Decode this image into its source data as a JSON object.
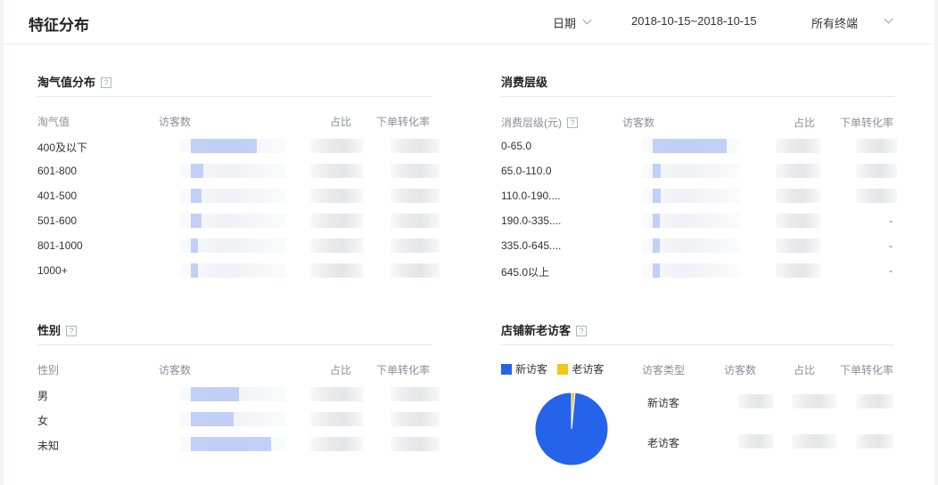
{
  "page_title": "特征分布",
  "filters": {
    "date_label": "日期",
    "date_range": "2018-10-15~2018-10-15",
    "terminal": "所有终端"
  },
  "colors": {
    "bar": "#b7c9f5",
    "new_visitor": "#2563eb",
    "old_visitor": "#f5c518"
  },
  "taoqi": {
    "title": "淘气值分布",
    "help": "?",
    "headers": {
      "c1": "淘气值",
      "c2": "访客数",
      "c3": "占比",
      "c4": "下单转化率"
    },
    "rows": [
      {
        "label": "400及以下",
        "share": 0.62
      },
      {
        "label": "601-800",
        "share": 0.12
      },
      {
        "label": "401-500",
        "share": 0.1
      },
      {
        "label": "501-600",
        "share": 0.1
      },
      {
        "label": "801-1000",
        "share": 0.06
      },
      {
        "label": "1000+",
        "share": 0.06
      }
    ]
  },
  "spending": {
    "title": "消费层级",
    "headers": {
      "c1": "消费层级(元)",
      "help": "?",
      "c2": "访客数",
      "c3": "占比",
      "c4": "下单转化率"
    },
    "rows": [
      {
        "label": "0-65.0",
        "share": 0.75,
        "rate": ""
      },
      {
        "label": "65.0-110.0",
        "share": 0.08,
        "rate": ""
      },
      {
        "label": "110.0-190....",
        "share": 0.08,
        "rate": ""
      },
      {
        "label": "190.0-335....",
        "share": 0.03,
        "rate": "-"
      },
      {
        "label": "335.0-645....",
        "share": 0.03,
        "rate": "-"
      },
      {
        "label": "645.0以上",
        "share": 0.03,
        "rate": "-"
      }
    ]
  },
  "gender": {
    "title": "性别",
    "help": "?",
    "headers": {
      "c1": "性别",
      "c2": "访客数",
      "c3": "占比",
      "c4": "下单转化率"
    },
    "rows": [
      {
        "label": "男",
        "share": 0.45
      },
      {
        "label": "女",
        "share": 0.4
      },
      {
        "label": "未知",
        "share": 0.75
      }
    ]
  },
  "visitors": {
    "title": "店铺新老访客",
    "help": "?",
    "legend": {
      "new": "新访客",
      "old": "老访客"
    },
    "headers": {
      "c1": "访客类型",
      "c2": "访客数",
      "c3": "占比",
      "c4": "下单转化率"
    },
    "rows": [
      {
        "label": "新访客"
      },
      {
        "label": "老访客"
      }
    ],
    "chart_data": {
      "type": "pie",
      "categories": [
        "新访客",
        "老访客"
      ],
      "values": [
        98.5,
        1.5
      ],
      "legend": "top-left"
    }
  }
}
